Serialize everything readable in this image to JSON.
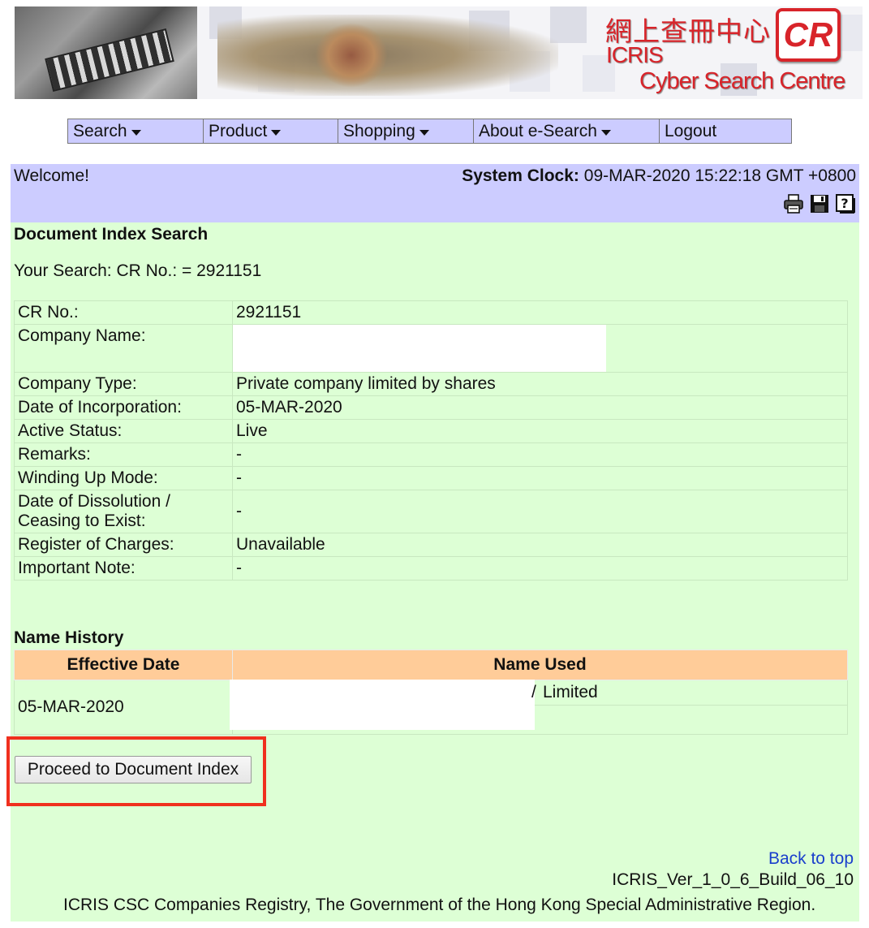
{
  "banner": {
    "logo_chinese": "網上查冊中心",
    "logo_badge": "CR",
    "logo_icris": "ICRIS",
    "logo_subtitle": "Cyber Search Centre"
  },
  "nav": {
    "items": [
      {
        "label": "Search",
        "dropdown": true
      },
      {
        "label": "Product",
        "dropdown": true
      },
      {
        "label": "Shopping",
        "dropdown": true
      },
      {
        "label": "About e-Search",
        "dropdown": true
      },
      {
        "label": "Logout",
        "dropdown": false
      }
    ]
  },
  "welcome": {
    "greeting": "Welcome!",
    "clock_label": "System Clock:",
    "clock_value": "09-MAR-2020 15:22:18 GMT +0800",
    "icons": [
      "printer-icon",
      "save-icon",
      "help-icon"
    ]
  },
  "page": {
    "title": "Document Index Search",
    "your_search": "Your Search: CR No.: = 2921151"
  },
  "company": {
    "rows": [
      {
        "label": "CR No.:",
        "value": "2921151"
      },
      {
        "label": "Company Name:",
        "value": ""
      },
      {
        "label": "Company Type:",
        "value": "Private company limited by shares"
      },
      {
        "label": "Date of Incorporation:",
        "value": "05-MAR-2020"
      },
      {
        "label": "Active Status:",
        "value": "Live"
      },
      {
        "label": "Remarks:",
        "value": "-"
      },
      {
        "label": "Winding Up Mode:",
        "value": "-"
      },
      {
        "label": "Date of Dissolution / Ceasing to Exist:",
        "value": "-"
      },
      {
        "label": "Register of Charges:",
        "value": "Unavailable"
      },
      {
        "label": "Important Note:",
        "value": "-"
      }
    ]
  },
  "name_history": {
    "title": "Name History",
    "col_date": "Effective Date",
    "col_name": "Name Used",
    "rows": [
      {
        "date": "05-MAR-2020",
        "name_visible": "Limited",
        "name_prefix": "/"
      }
    ]
  },
  "actions": {
    "proceed_label": "Proceed to Document Index"
  },
  "footer": {
    "back_to_top": "Back to top",
    "version": "ICRIS_Ver_1_0_6_Build_06_10",
    "copyright": "ICRIS CSC Companies Registry, The Government of the Hong Kong Special Administrative Region."
  },
  "colors": {
    "nav_bg": "#ccccff",
    "main_bg": "#ddffd5",
    "table_header_bg": "#ffcc99",
    "highlight_border": "#f0301e",
    "link": "#1a3fcc",
    "logo_red": "#d8242a"
  }
}
